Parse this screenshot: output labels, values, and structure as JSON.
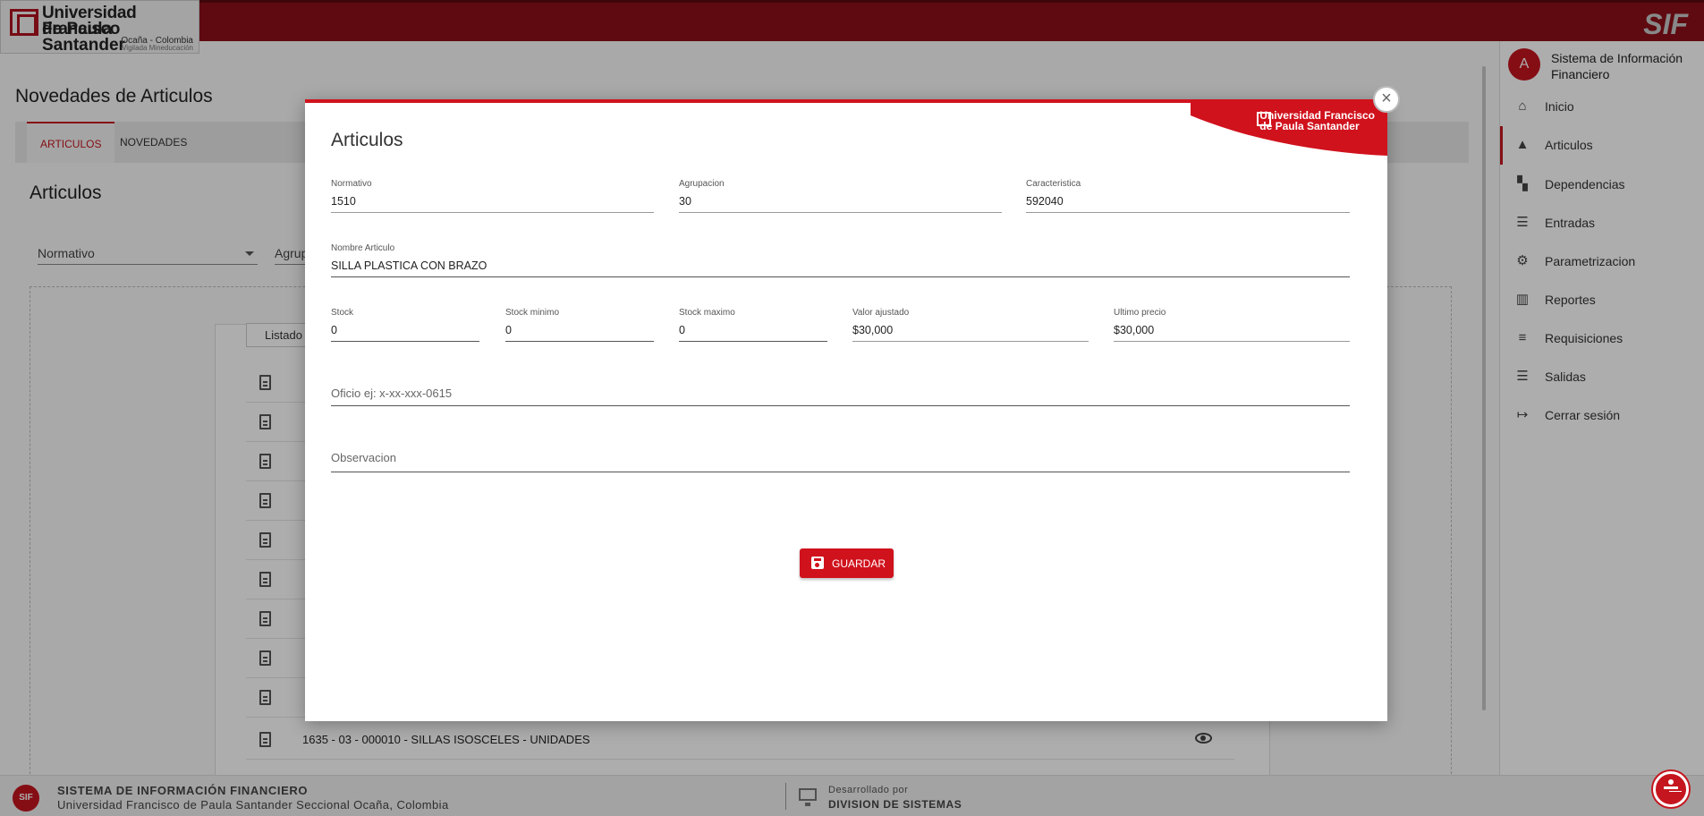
{
  "header": {
    "logo_line1": "Universidad Francisco",
    "logo_line2": "de Paula Santander",
    "logo_line3": "Ocaña - Colombia",
    "logo_line4": "Vigilada Mineducación",
    "brand": "SIF"
  },
  "main": {
    "page_title": "Novedades de Articulos",
    "tabs": [
      {
        "label": "ARTICULOS",
        "active": true
      },
      {
        "label": "NOVEDADES",
        "active": false
      }
    ],
    "section_title": "Articulos",
    "filters": {
      "normativo": "Normativo",
      "agrupacion": "Agrup"
    },
    "list_header": "Listado d",
    "rows": [
      {
        "text": "1635 - 03 - 000010 - SILLAS ISOSCELES - UNIDADES"
      }
    ]
  },
  "sidebar": {
    "avatar_letter": "A",
    "title": "Sistema de Información Financiero",
    "items": [
      {
        "label": "Inicio",
        "icon": "home-icon",
        "active": false
      },
      {
        "label": "Articulos",
        "icon": "shapes-icon",
        "active": true
      },
      {
        "label": "Dependencias",
        "icon": "hierarchy-icon",
        "active": false
      },
      {
        "label": "Entradas",
        "icon": "list-indent-icon",
        "active": false
      },
      {
        "label": "Parametrizacion",
        "icon": "gears-icon",
        "active": false
      },
      {
        "label": "Reportes",
        "icon": "bar-chart-icon",
        "active": false
      },
      {
        "label": "Requisiciones",
        "icon": "list-lines-icon",
        "active": false
      },
      {
        "label": "Salidas",
        "icon": "list-outdent-icon",
        "active": false
      },
      {
        "label": "Cerrar sesión",
        "icon": "logout-icon",
        "active": false
      }
    ]
  },
  "modal": {
    "title": "Articulos",
    "corner_logo_line1": "Universidad Francisco",
    "corner_logo_line2": "de Paula Santander",
    "close_symbol": "×",
    "fields": {
      "normativo": {
        "label": "Normativo",
        "value": "1510"
      },
      "agrupacion": {
        "label": "Agrupacion",
        "value": "30"
      },
      "caracteristica": {
        "label": "Caracteristica",
        "value": "592040"
      },
      "nombre": {
        "label": "Nombre Articulo",
        "value": "SILLA PLASTICA CON BRAZO"
      },
      "stock": {
        "label": "Stock",
        "value": "0"
      },
      "stock_min": {
        "label": "Stock minimo",
        "value": "0"
      },
      "stock_max": {
        "label": "Stock maximo",
        "value": "0"
      },
      "valor": {
        "label": "Valor ajustado",
        "value": "$30,000"
      },
      "ultimo": {
        "label": "Ultimo precio",
        "value": "$30,000"
      },
      "oficio": {
        "placeholder": "Oficio ej: x-xx-xxx-0615"
      },
      "observacion": {
        "placeholder": "Observacion"
      }
    },
    "save_label": "GUARDAR"
  },
  "footer": {
    "logo": "SIF",
    "line1": "SISTEMA DE INFORMACIÓN FINANCIERO",
    "line2": "Universidad Francisco de Paula Santander Seccional Ocaña, Colombia",
    "dev_line1": "Desarrollado por",
    "dev_line2": "DIVISION DE SISTEMAS"
  }
}
